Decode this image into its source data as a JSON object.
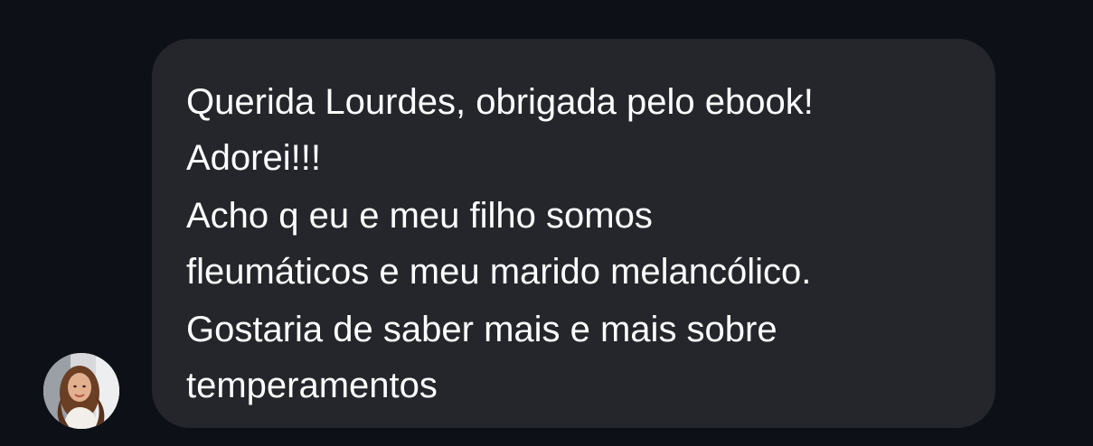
{
  "message": {
    "paragraphs": [
      {
        "lines": [
          "Querida Lourdes, obrigada pelo ebook!",
          "Adorei!!!"
        ]
      },
      {
        "lines": [
          "Acho q eu e meu filho somos",
          "fleumáticos e meu marido melancólico."
        ]
      },
      {
        "lines": [
          "Gostaria de saber mais e mais sobre",
          "temperamentos"
        ]
      }
    ]
  },
  "colors": {
    "background": "#0d1117",
    "bubble": "#24262b",
    "text": "#ffffff"
  },
  "avatar": {
    "icon": "user-photo-avatar"
  }
}
